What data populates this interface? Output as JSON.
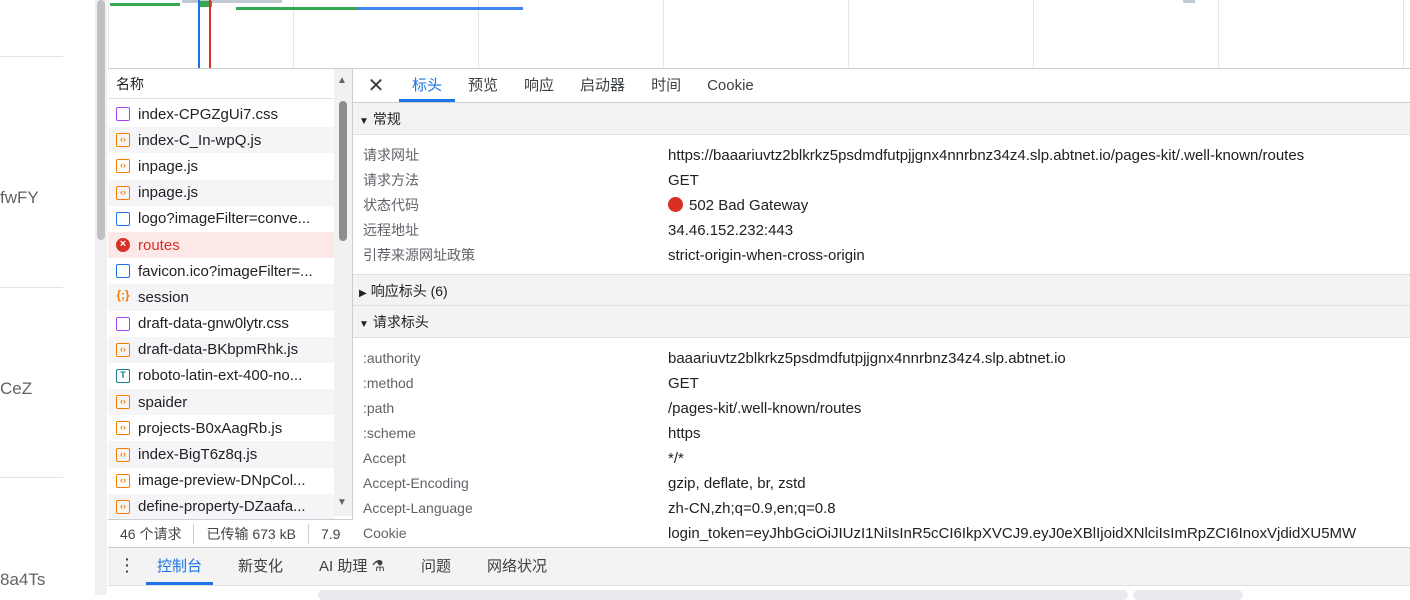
{
  "page_fragments": [
    "fwFY",
    "CeZ",
    "8a4Ts"
  ],
  "request_list": {
    "header": "名称",
    "rows": [
      {
        "name": "index-CPGZgUi7.css",
        "type": "css",
        "icon": "css-file-icon"
      },
      {
        "name": "index-C_In-wpQ.js",
        "type": "js",
        "icon": "script-file-icon"
      },
      {
        "name": "inpage.js",
        "type": "js",
        "icon": "script-file-icon"
      },
      {
        "name": "inpage.js",
        "type": "js",
        "icon": "script-file-icon"
      },
      {
        "name": "logo?imageFilter=conve...",
        "type": "img",
        "icon": "image-file-icon"
      },
      {
        "name": "routes",
        "type": "err",
        "icon": "error-icon"
      },
      {
        "name": "favicon.ico?imageFilter=...",
        "type": "img",
        "icon": "image-file-icon"
      },
      {
        "name": "session",
        "type": "json",
        "icon": "json-file-icon"
      },
      {
        "name": "draft-data-gnw0lytr.css",
        "type": "css",
        "icon": "css-file-icon"
      },
      {
        "name": "draft-data-BKbpmRhk.js",
        "type": "js",
        "icon": "script-file-icon"
      },
      {
        "name": "roboto-latin-ext-400-no...",
        "type": "font",
        "icon": "font-file-icon"
      },
      {
        "name": "spaider",
        "type": "js",
        "icon": "script-file-icon"
      },
      {
        "name": "projects-B0xAagRb.js",
        "type": "js",
        "icon": "script-file-icon"
      },
      {
        "name": "index-BigT6z8q.js",
        "type": "js",
        "icon": "script-file-icon"
      },
      {
        "name": "image-preview-DNpCol...",
        "type": "js",
        "icon": "script-file-icon"
      },
      {
        "name": "define-property-DZaafa...",
        "type": "js",
        "icon": "script-file-icon"
      }
    ]
  },
  "summary": {
    "requests": "46 个请求",
    "transferred": "已传输 673 kB",
    "extra": "7.9"
  },
  "detail": {
    "tabs": [
      "标头",
      "预览",
      "响应",
      "启动器",
      "时间",
      "Cookie"
    ],
    "active_tab": "标头",
    "general": {
      "title": "常规",
      "rows": [
        {
          "k": "请求网址",
          "v": "https://baaariuvtz2blkrkz5psdmdfutpjjgnx4nnrbnz34z4.slp.abtnet.io/pages-kit/.well-known/routes"
        },
        {
          "k": "请求方法",
          "v": "GET"
        },
        {
          "k": "状态代码",
          "v": "502 Bad Gateway"
        },
        {
          "k": "远程地址",
          "v": "34.46.152.232:443"
        },
        {
          "k": "引荐来源网址政策",
          "v": "strict-origin-when-cross-origin"
        }
      ]
    },
    "response_headers": {
      "title": "响应标头 (6)"
    },
    "request_headers": {
      "title": "请求标头",
      "rows": [
        {
          "k": ":authority",
          "v": "baaariuvtz2blkrkz5psdmdfutpjjgnx4nnrbnz34z4.slp.abtnet.io"
        },
        {
          "k": ":method",
          "v": "GET"
        },
        {
          "k": ":path",
          "v": "/pages-kit/.well-known/routes"
        },
        {
          "k": ":scheme",
          "v": "https"
        },
        {
          "k": "Accept",
          "v": "*/*"
        },
        {
          "k": "Accept-Encoding",
          "v": "gzip, deflate, br, zstd"
        },
        {
          "k": "Accept-Language",
          "v": "zh-CN,zh;q=0.9,en;q=0.8"
        },
        {
          "k": "Cookie",
          "v": "login_token=eyJhbGciOiJIUzI1NiIsInR5cCI6IkpXVCJ9.eyJ0eXBlIjoidXNlciIsImRpZCI6InoxVjdidXU5MW"
        }
      ]
    }
  },
  "drawer": {
    "tabs": [
      "控制台",
      "新变化",
      "AI 助理 ⚗",
      "问题",
      "网络状况"
    ],
    "active_tab": "控制台"
  },
  "colors": {
    "accent": "#1a73e8",
    "error": "#d93025"
  }
}
